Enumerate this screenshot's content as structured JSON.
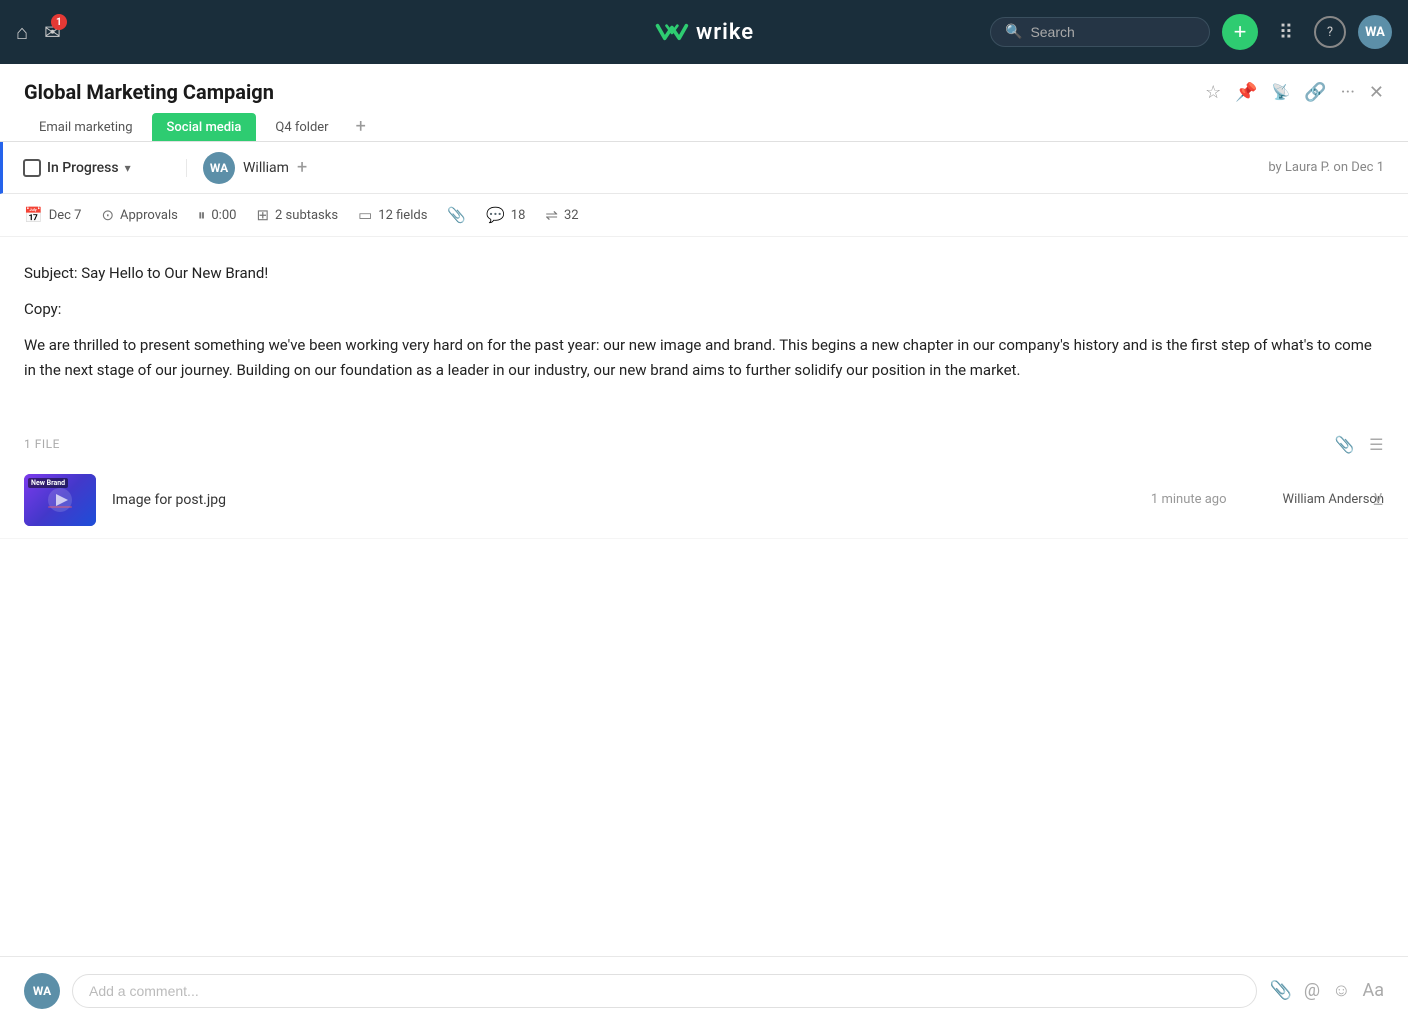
{
  "nav": {
    "search_placeholder": "Search",
    "add_btn_label": "+",
    "mail_badge": "1",
    "user_initials": "WA"
  },
  "page": {
    "title": "Global Marketing Campaign",
    "header_icons": [
      "star",
      "pin",
      "rss",
      "link",
      "more",
      "close"
    ]
  },
  "tabs": [
    {
      "label": "Email marketing",
      "active": false
    },
    {
      "label": "Social media",
      "active": true
    },
    {
      "label": "Q4 folder",
      "active": false
    }
  ],
  "task": {
    "status": "In Progress",
    "assignee_name": "William",
    "meta_right": "by Laura P. on Dec 1"
  },
  "meta_items": [
    {
      "icon": "📅",
      "label": "Dec 7"
    },
    {
      "icon": "✓",
      "label": "Approvals"
    },
    {
      "icon": "⏸",
      "label": "0:00"
    },
    {
      "icon": "⊞",
      "label": "2 subtasks"
    },
    {
      "icon": "▭",
      "label": "12 fields"
    },
    {
      "icon": "📎",
      "label": ""
    },
    {
      "icon": "⊡",
      "label": "18"
    },
    {
      "icon": "⇌",
      "label": "32"
    }
  ],
  "content": {
    "subject_line": "Subject: Say Hello to Our New Brand!",
    "copy_label": "Copy:",
    "body": "We are thrilled to present something we've been working very hard on for the past year: our new image and brand. This begins a new chapter in our company's history and is the first step of what's to come in the next stage of our journey. Building on our foundation as a leader in our industry, our new brand aims to further solidify our position in the market."
  },
  "files": {
    "section_label": "1 FILE",
    "items": [
      {
        "name": "Image for post.jpg",
        "time": "1 minute ago",
        "uploader": "William Anderson",
        "thumb_text": "New Brand"
      }
    ]
  },
  "comment": {
    "placeholder": "Add a comment...",
    "user_initials": "WA"
  }
}
